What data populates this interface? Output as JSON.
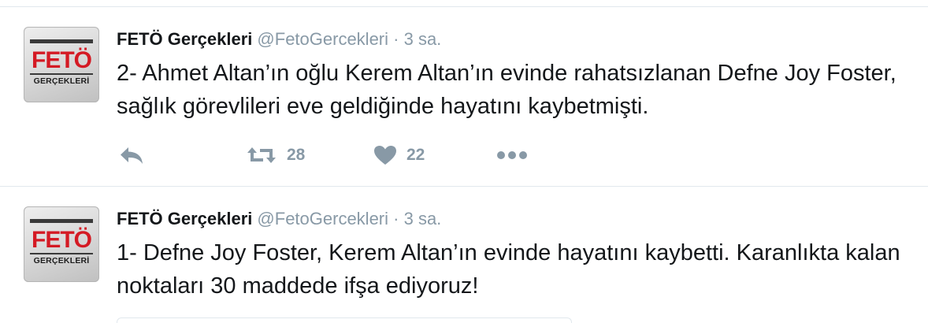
{
  "tweets": [
    {
      "author_name": "FETÖ Gerçekleri",
      "handle": "@FetoGercekleri",
      "time": "· 3 sa.",
      "text": "2- Ahmet Altan’ın oğlu Kerem Altan’ın evinde rahatsızlanan Defne Joy Foster, sağlık görevlileri eve geldiğinde hayatını kaybetmişti.",
      "avatar": {
        "line1": "FETÖ",
        "line2": "GERÇEKLERİ"
      },
      "retweets": "28",
      "likes": "22"
    },
    {
      "author_name": "FETÖ Gerçekleri",
      "handle": "@FetoGercekleri",
      "time": "· 3 sa.",
      "text": "1- Defne Joy Foster, Kerem Altan’ın evinde hayatını kaybetti. Karanlıkta kalan noktaları 30 maddede ifşa ediyoruz!",
      "avatar": {
        "line1": "FETÖ",
        "line2": "GERÇEKLERİ"
      }
    }
  ],
  "icons": [
    "reply-icon",
    "retweet-icon",
    "like-icon",
    "more-icon"
  ],
  "colors": {
    "text": "#14171a",
    "muted": "#8899a6",
    "brand_red": "#d41a24",
    "divider": "#e1e8ed"
  }
}
